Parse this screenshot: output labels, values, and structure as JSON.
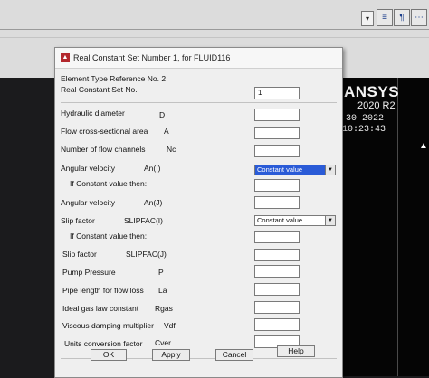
{
  "toolbar": {
    "dropdown_glyph": "▾",
    "icon1": "≡",
    "icon2": "¶",
    "icon3": "⋯"
  },
  "graphics": {
    "logo": "ANSYS",
    "version": "2020 R2",
    "date": "30 2022",
    "time": "10:23:43"
  },
  "dialog": {
    "title": "Real Constant Set Number 1, for FLUID116",
    "element_type_ref": "Element Type Reference No. 2",
    "set_no_label": "Real Constant Set No.",
    "set_no_value": "1",
    "fields": [
      {
        "label": "Hydraulic diameter",
        "symbol": "D",
        "value": ""
      },
      {
        "label": "Flow cross-sectional area",
        "symbol": "A",
        "value": ""
      },
      {
        "label": "Number of flow channels",
        "symbol": "Nc",
        "value": ""
      },
      {
        "label": "Angular velocity",
        "symbol": "An(I)",
        "select": "Constant value"
      },
      {
        "label": "If Constant value then:",
        "symbol": "",
        "value": ""
      },
      {
        "label": "Angular velocity",
        "symbol": "An(J)",
        "value": ""
      },
      {
        "label": "Slip factor",
        "symbol": "SLIPFAC(I)",
        "select": "Constant value"
      },
      {
        "label": "If Constant value then:",
        "symbol": "",
        "value": ""
      },
      {
        "label": "Slip factor",
        "symbol": "SLIPFAC(J)",
        "value": ""
      },
      {
        "label": "Pump Pressure",
        "symbol": "P",
        "value": ""
      },
      {
        "label": "Pipe length for flow loss",
        "symbol": "La",
        "value": ""
      },
      {
        "label": "Ideal gas law constant",
        "symbol": "Rgas",
        "value": ""
      },
      {
        "label": "Viscous damping multiplier",
        "symbol": "Vdf",
        "value": ""
      },
      {
        "label": "Units conversion factor",
        "symbol": "Cver",
        "value": ""
      }
    ],
    "buttons": {
      "ok": "OK",
      "apply": "Apply",
      "cancel": "Cancel",
      "help": "Help"
    }
  },
  "colors": {
    "selected_dropdown": "#2a5bd7",
    "dialog_bg": "#efefef",
    "graphics_bg": "#050505"
  }
}
